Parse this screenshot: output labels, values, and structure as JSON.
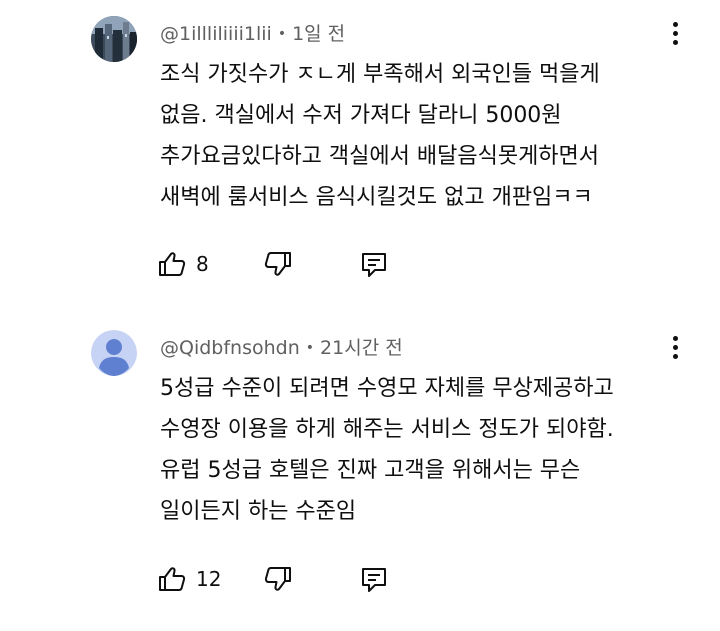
{
  "comments": [
    {
      "handle": "@1illliliiii1lii",
      "time": "1일 전",
      "avatar": "photo-avatar",
      "lines": [
        "조식 가짓수가 ㅈㄴ게 부족해서 외국인들 먹을게",
        "없음. 객실에서 수저 가져다 달라니 5000원",
        "추가요금있다하고 객실에서 배달음식못게하면서",
        "새벽에 룸서비스 음식시킬것도 없고 개판임ㅋㅋ"
      ],
      "likes": "8"
    },
    {
      "handle": "@Qidbfnsohdn",
      "time": "21시간 전",
      "avatar": "default-person-avatar",
      "lines": [
        "5성급 수준이 되려면 수영모 자체를 무상제공하고",
        "수영장 이용을 하게 해주는 서비스 정도가 되야함.",
        "유럽 5성급 호텔은 진짜 고객을 위해서는 무슨",
        "일이든지 하는 수준임"
      ],
      "likes": "12"
    }
  ],
  "separator": "•",
  "colors": {
    "text": "#0f0f0f",
    "meta": "#606060",
    "default_avatar_bg": "#c6d3f5",
    "default_avatar_fg": "#5f7fd1"
  },
  "icons": [
    "like-icon",
    "dislike-icon",
    "reply-icon",
    "more-options-icon"
  ]
}
